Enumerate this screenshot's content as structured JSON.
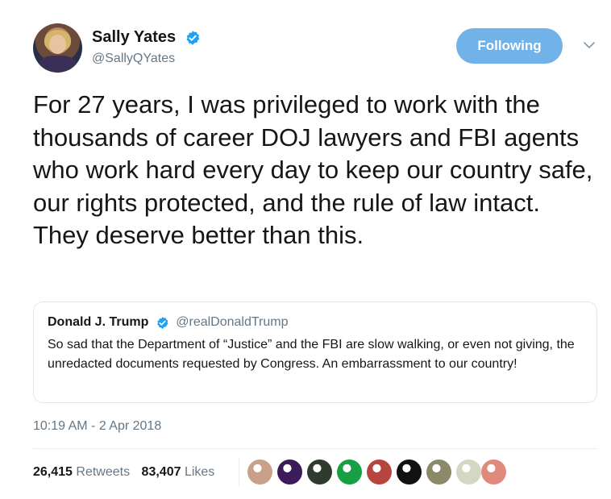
{
  "author": {
    "display_name": "Sally Yates",
    "handle": "@SallyQYates",
    "verified_icon": "verified-badge-icon",
    "avatar_icon": "profile-photo"
  },
  "follow_button": {
    "label": "Following",
    "color": "#71b3e8"
  },
  "menu_icon": "chevron-down-icon",
  "tweet": {
    "text": "For 27 years, I was privileged to work with the thousands of career DOJ lawyers and FBI agents who work hard every day to keep our country safe, our rights protected, and the rule of law intact. They deserve better than this.",
    "timestamp": "10:19 AM - 2 Apr 2018"
  },
  "quoted_tweet": {
    "display_name": "Donald J. Trump",
    "handle": "@realDonaldTrump",
    "text": "So sad that the Department of “Justice” and the FBI are slow walking, or even not giving, the unredacted documents requested by Congress. An embarrassment to our country!"
  },
  "stats": {
    "retweets_count": "26,415",
    "retweets_label": "Retweets",
    "likes_count": "83,407",
    "likes_label": "Likes"
  },
  "likers": [
    {
      "icon": "liker-avatar-woman",
      "color": "#c9a089"
    },
    {
      "icon": "liker-avatar-purple-text",
      "color": "#3b1b58"
    },
    {
      "icon": "liker-avatar-alien",
      "color": "#2e3b2e"
    },
    {
      "icon": "liker-avatar-green-figure",
      "color": "#16a043"
    },
    {
      "icon": "liker-avatar-woman-red",
      "color": "#b5463f"
    },
    {
      "icon": "liker-avatar-chevron",
      "color": "#111111"
    },
    {
      "icon": "liker-avatar-camo",
      "color": "#8a8a6a"
    },
    {
      "icon": "liker-avatar-seal",
      "color": "#d6d6c4"
    },
    {
      "icon": "liker-avatar-fox",
      "color": "#e08a7d"
    }
  ],
  "colors": {
    "text": "#14171a",
    "secondary": "#657786",
    "border": "#e1e8ed",
    "verified": "#1da1f2"
  }
}
